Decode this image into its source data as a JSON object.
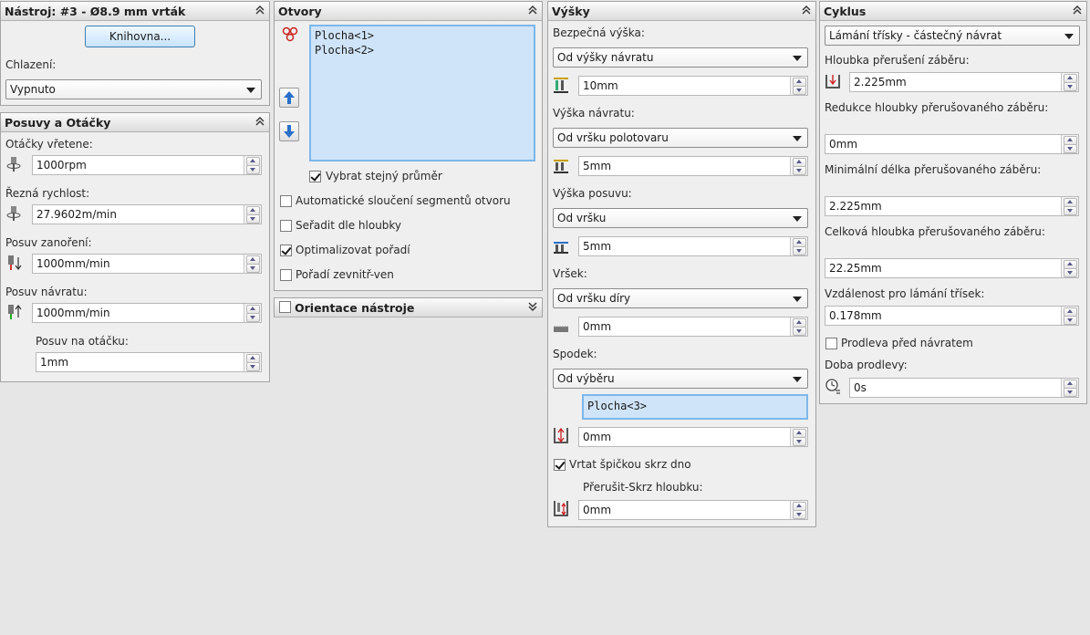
{
  "tool": {
    "title": "Nástroj: #3 - Ø8.9 mm vrták",
    "library_button": "Knihovna...",
    "coolant_label": "Chlazení:",
    "coolant_value": "Vypnuto"
  },
  "feeds": {
    "title": "Posuvy a Otáčky",
    "spindle_label": "Otáčky vřetene:",
    "spindle_value": "1000rpm",
    "cutting_label": "Řezná rychlost:",
    "cutting_value": "27.9602m/min",
    "plunge_label": "Posuv zanoření:",
    "plunge_value": "1000mm/min",
    "retract_label": "Posuv návratu:",
    "retract_value": "1000mm/min",
    "per_rev_label": "Posuv na otáčku:",
    "per_rev_value": "1mm"
  },
  "holes": {
    "title": "Otvory",
    "items": [
      "Plocha<1>",
      "Plocha<2>"
    ],
    "same_diameter": "Vybrat stejný průměr",
    "auto_merge": "Automatické sloučení segmentů otvoru",
    "sort_depth": "Seřadit dle hloubky",
    "optimize_order": "Optimalizovat pořadí",
    "inside_out": "Pořadí zevnitř-ven"
  },
  "orientation": {
    "title": "Orientace nástroje"
  },
  "heights": {
    "title": "Výšky",
    "clearance_label": "Bezpečná výška:",
    "clearance_mode": "Od výšky návratu",
    "clearance_value": "10mm",
    "retract_label": "Výška návratu:",
    "retract_mode": "Od vršku polotovaru",
    "retract_value": "5mm",
    "feed_label": "Výška posuvu:",
    "feed_mode": "Od vršku",
    "feed_value": "5mm",
    "top_label": "Vršek:",
    "top_mode": "Od vršku díry",
    "top_value": "0mm",
    "bottom_label": "Spodek:",
    "bottom_mode": "Od výběru",
    "bottom_selection": "Plocha<3>",
    "bottom_value": "0mm",
    "tip_through": "Vrtat špičkou skrz dno",
    "break_through_label": "Přerušit-Skrz hloubku:",
    "break_through_value": "0mm"
  },
  "cycle": {
    "title": "Cyklus",
    "type_value": "Lámání třísky - částečný návrat",
    "peck_label": "Hloubka přerušení záběru:",
    "peck_value": "2.225mm",
    "reduction_label": "Redukce hloubky přerušovaného záběru:",
    "reduction_value": "0mm",
    "min_len_label": "Minimální délka přerušovaného záběru:",
    "min_len_value": "2.225mm",
    "total_label": "Celková hloubka přerušovaného záběru:",
    "total_value": "22.25mm",
    "chip_label": "Vzdálenost pro lámání třísek:",
    "chip_value": "0.178mm",
    "dwell_check": "Prodleva před návratem",
    "dwell_label": "Doba prodlevy:",
    "dwell_value": "0s"
  },
  "colors": {
    "panel_bg": "#efefef",
    "selection_bg": "#cfe4f8",
    "selection_border": "#7db7ea"
  }
}
